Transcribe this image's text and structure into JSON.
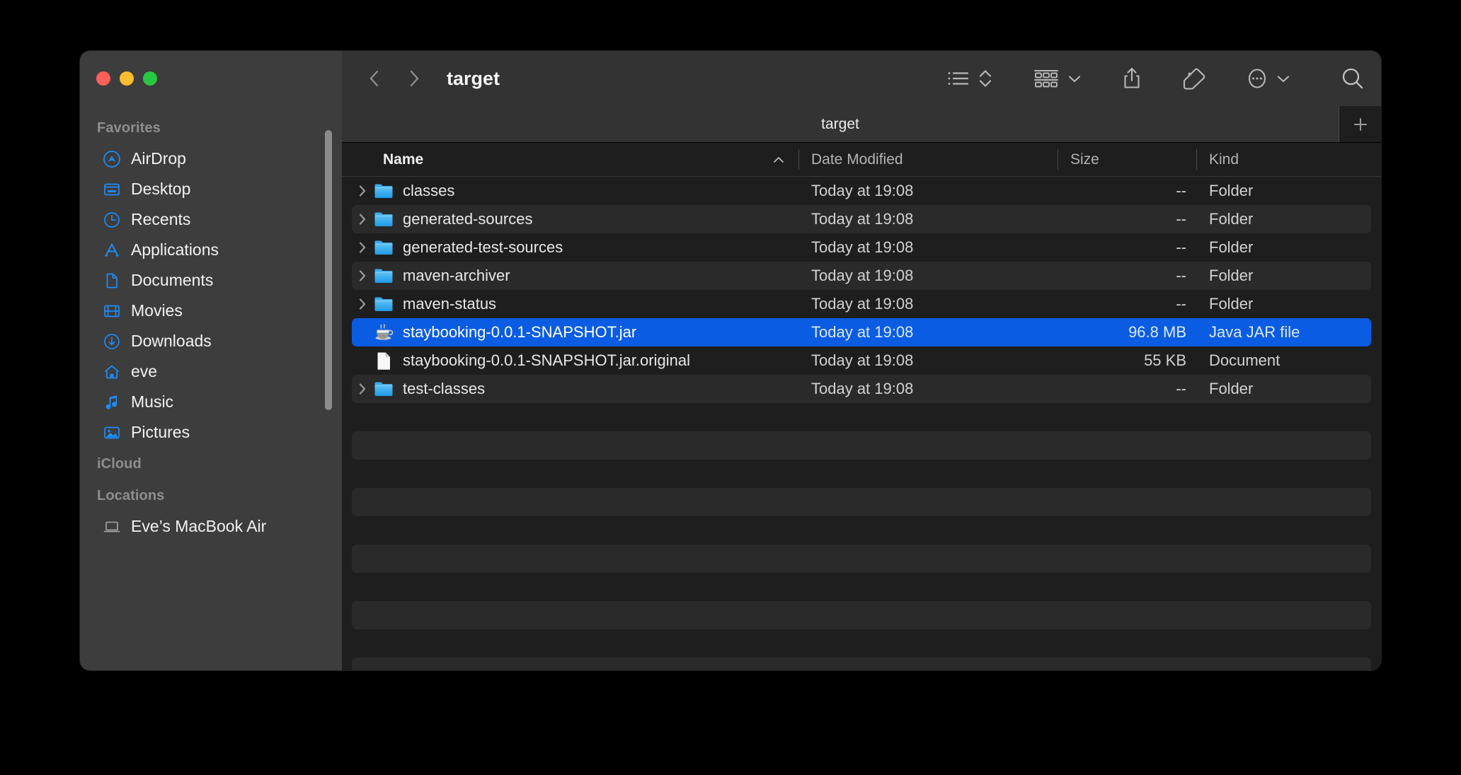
{
  "window": {
    "title": "target",
    "traffic_lights": [
      {
        "name": "close",
        "color": "#ff5f57"
      },
      {
        "name": "minimize",
        "color": "#febc2e"
      },
      {
        "name": "maximize",
        "color": "#28c840"
      }
    ]
  },
  "sidebar": {
    "groups": [
      {
        "title": "Favorites",
        "items": [
          {
            "label": "AirDrop",
            "icon": "airdrop-icon"
          },
          {
            "label": "Desktop",
            "icon": "desktop-icon"
          },
          {
            "label": "Recents",
            "icon": "clock-icon"
          },
          {
            "label": "Applications",
            "icon": "applications-icon"
          },
          {
            "label": "Documents",
            "icon": "document-icon"
          },
          {
            "label": "Movies",
            "icon": "film-icon"
          },
          {
            "label": "Downloads",
            "icon": "download-icon"
          },
          {
            "label": "eve",
            "icon": "home-icon"
          },
          {
            "label": "Music",
            "icon": "music-note-icon"
          },
          {
            "label": "Pictures",
            "icon": "photo-icon"
          }
        ]
      },
      {
        "title": "iCloud",
        "items": []
      },
      {
        "title": "Locations",
        "items": [
          {
            "label": "Eve’s MacBook Air",
            "icon": "laptop-icon"
          }
        ]
      }
    ]
  },
  "toolbar": {
    "back_label": "Back",
    "forward_label": "Forward",
    "items": [
      {
        "name": "list-view-icon",
        "label": "List View"
      },
      {
        "name": "sort-chevrons-icon",
        "label": "Sort"
      },
      {
        "name": "group-by-icon",
        "label": "Group"
      },
      {
        "name": "share-icon",
        "label": "Share"
      },
      {
        "name": "tag-icon",
        "label": "Tags"
      },
      {
        "name": "more-actions-icon",
        "label": "More"
      },
      {
        "name": "search-icon",
        "label": "Search"
      }
    ]
  },
  "tabbar": {
    "active_tab_label": "target",
    "new_tab_label": "+"
  },
  "columns": [
    {
      "key": "name",
      "label": "Name",
      "sorted": true,
      "sort_direction": "ascending"
    },
    {
      "key": "date",
      "label": "Date Modified"
    },
    {
      "key": "size",
      "label": "Size"
    },
    {
      "key": "kind",
      "label": "Kind"
    }
  ],
  "files": [
    {
      "name": "classes",
      "date": "Today at 19:08",
      "size": "--",
      "kind": "Folder",
      "icon": "folder-icon",
      "expandable": true,
      "selected": false
    },
    {
      "name": "generated-sources",
      "date": "Today at 19:08",
      "size": "--",
      "kind": "Folder",
      "icon": "folder-icon",
      "expandable": true,
      "selected": false
    },
    {
      "name": "generated-test-sources",
      "date": "Today at 19:08",
      "size": "--",
      "kind": "Folder",
      "icon": "folder-icon",
      "expandable": true,
      "selected": false
    },
    {
      "name": "maven-archiver",
      "date": "Today at 19:08",
      "size": "--",
      "kind": "Folder",
      "icon": "folder-icon",
      "expandable": true,
      "selected": false
    },
    {
      "name": "maven-status",
      "date": "Today at 19:08",
      "size": "--",
      "kind": "Folder",
      "icon": "folder-icon",
      "expandable": true,
      "selected": false
    },
    {
      "name": "staybooking-0.0.1-SNAPSHOT.jar",
      "date": "Today at 19:08",
      "size": "96.8 MB",
      "kind": "Java JAR file",
      "icon": "java-jar-icon",
      "expandable": false,
      "selected": true
    },
    {
      "name": "staybooking-0.0.1-SNAPSHOT.jar.original",
      "date": "Today at 19:08",
      "size": "55 KB",
      "kind": "Document",
      "icon": "document-file-icon",
      "expandable": false,
      "selected": false
    },
    {
      "name": "test-classes",
      "date": "Today at 19:08",
      "size": "--",
      "kind": "Folder",
      "icon": "folder-icon",
      "expandable": true,
      "selected": false
    }
  ],
  "empty_row_count": 12,
  "colors": {
    "selection_blue": "#0a5ce3",
    "sidebar_bg": "#3d3d3d",
    "content_bg": "#1e1e1e",
    "toolbar_bg": "#333333",
    "alt_row": "#2a2a2a",
    "accent_icon_blue": "#1f8cf5",
    "desktop_bg": "#000000"
  }
}
